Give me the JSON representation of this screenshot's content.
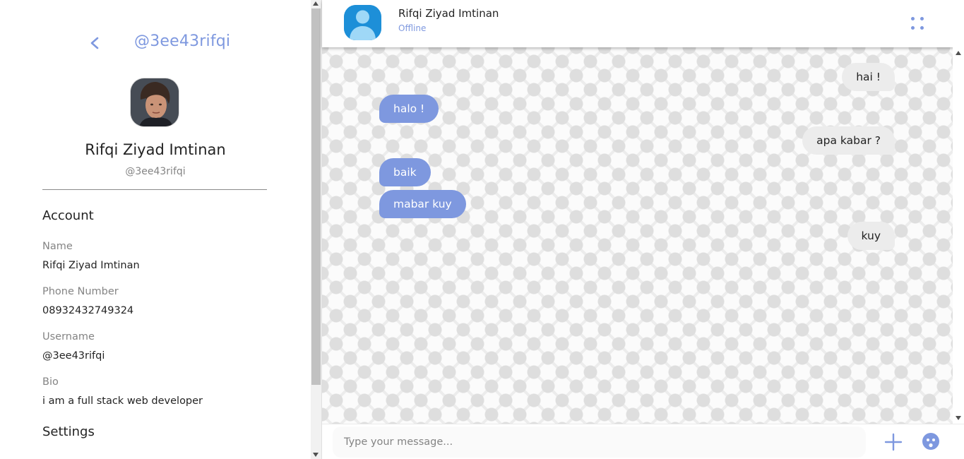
{
  "profile": {
    "back_icon": "chevron-left-icon",
    "handle_title": "@3ee43rifqi",
    "name": "Rifqi Ziyad Imtinan",
    "handle": "@3ee43rifqi",
    "account_title": "Account",
    "fields": [
      {
        "label": "Name",
        "value": "Rifqi Ziyad Imtinan"
      },
      {
        "label": "Phone Number",
        "value": "08932432749324"
      },
      {
        "label": "Username",
        "value": "@3ee43rifqi"
      },
      {
        "label": "Bio",
        "value": "i am a full stack web developer"
      }
    ],
    "settings_title": "Settings"
  },
  "chat": {
    "contact_name": "Rifqi Ziyad Imtinan",
    "contact_status": "Offline",
    "menu_icon": "four-dots-menu-icon",
    "messages": [
      {
        "from": "me",
        "text": "hai !"
      },
      {
        "from": "them",
        "text": "halo !"
      },
      {
        "from": "me",
        "text": "apa kabar ?"
      },
      {
        "from": "them",
        "text": "baik"
      },
      {
        "from": "them",
        "text": "mabar kuy"
      },
      {
        "from": "me",
        "text": "kuy"
      }
    ],
    "composer": {
      "placeholder": "Type your message...",
      "add_icon": "plus-icon",
      "emoji_icon": "emoji-icon"
    }
  },
  "colors": {
    "accent": "#7e98df",
    "incoming_bubble": "#7e98df",
    "outgoing_bubble": "#ececec",
    "text_primary": "#232323",
    "text_muted": "#848484"
  }
}
